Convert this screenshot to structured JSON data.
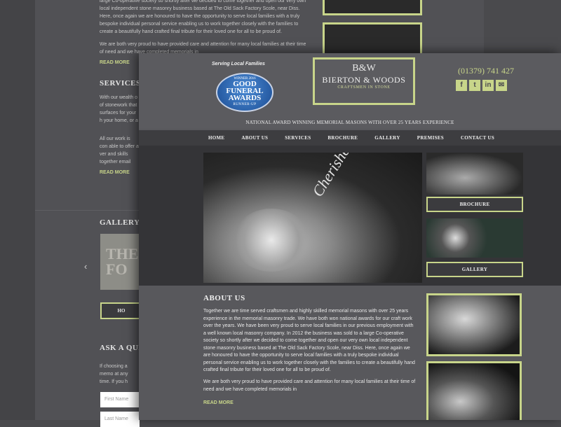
{
  "background_page": {
    "intro_lines": "large Co-operative society so shortly after we decided to come together and open our very own local independent stone masonry business based at The Old Sack Factory Scole, near Diss. Here, once again we are honoured to have the opportunity to serve local families with a truly bespoke individual personal service enabling us to work together closely with the families to create a beautifully hand crafted final tribute for their loved one for all to be proud of.",
    "proud_text": "We are both very proud to have provided care and attention for many local families at their time of need and  we have completed memorials in",
    "read_more_1": "READ MORE",
    "services_heading": "SERVICES",
    "services_text_1": "With our wealth o of stonework that surfaces for your h your home, or a n services.",
    "services_text_2": "All our work is con able to offer a ver and skills together email service, we c",
    "read_more_2": "READ MORE",
    "gallery_heading": "GALLERY",
    "gallery_image_text": "THE FO",
    "gallery_button": "HO",
    "ask_heading": "ASK A QUE",
    "ask_text": "If choosing a memo at any time. If you h advice, please do n",
    "first_name_placeholder": "First Name",
    "last_name_placeholder": "Last Name"
  },
  "header": {
    "serving": "Serving Local Families",
    "award": {
      "line1": "WINNER 2016",
      "title": "GOOD FUNERAL AWARDS",
      "ribbon": "RUNNER-UP"
    },
    "logo": {
      "monogram": "B&W",
      "name": "BIERTON & WOODS",
      "tagline": "CRAFTSMEN IN STONE"
    },
    "phone": "(01379) 741 427",
    "social": [
      {
        "icon": "facebook-icon",
        "glyph": "f"
      },
      {
        "icon": "twitter-icon",
        "glyph": "t"
      },
      {
        "icon": "linkedin-icon",
        "glyph": "in"
      },
      {
        "icon": "email-icon",
        "glyph": "✉"
      }
    ],
    "tagline": "NATIONAL AWARD WINNING MEMORIAL MASONS WITH OVER 25 YEARS EXPERIENCE"
  },
  "nav": {
    "items": [
      "HOME",
      "ABOUT US",
      "SERVICES",
      "BROCHURE",
      "GALLERY",
      "PREMISES",
      "CONTACT US"
    ]
  },
  "hero": {
    "inscription": "Cherished Memories of Mich"
  },
  "sidebar": {
    "brochure": "BROCHURE",
    "gallery": "GALLERY"
  },
  "about": {
    "heading": "ABOUT US",
    "paragraph1": "Together we are time served craftsmen and highly skilled memorial masons with over 25 years experience in the memorial masonry trade. We have both won national awards for our craft work over the years.  We have been very proud to serve local families in our previous employment with a well known local masonry company. In 2012 the business was sold to a large Co-operative society so shortly after we decided to come together and open our very own local independent stone masonry business based at The Old Sack Factory Scole, near Diss. Here, once again we are honoured to have the opportunity to serve local families with a truly bespoke individual personal service enabling us to work together closely with the families to create a beautifully hand crafted final tribute for their loved one for all to be proud of.",
    "paragraph2": "We are both very proud to have provided care and attention for many local families at their time of need and  we have completed memorials in",
    "read_more": "READ MORE"
  },
  "colors": {
    "accent": "#c8d58a",
    "nav_bg": "#3d3d40",
    "page_bg": "#58585c"
  }
}
